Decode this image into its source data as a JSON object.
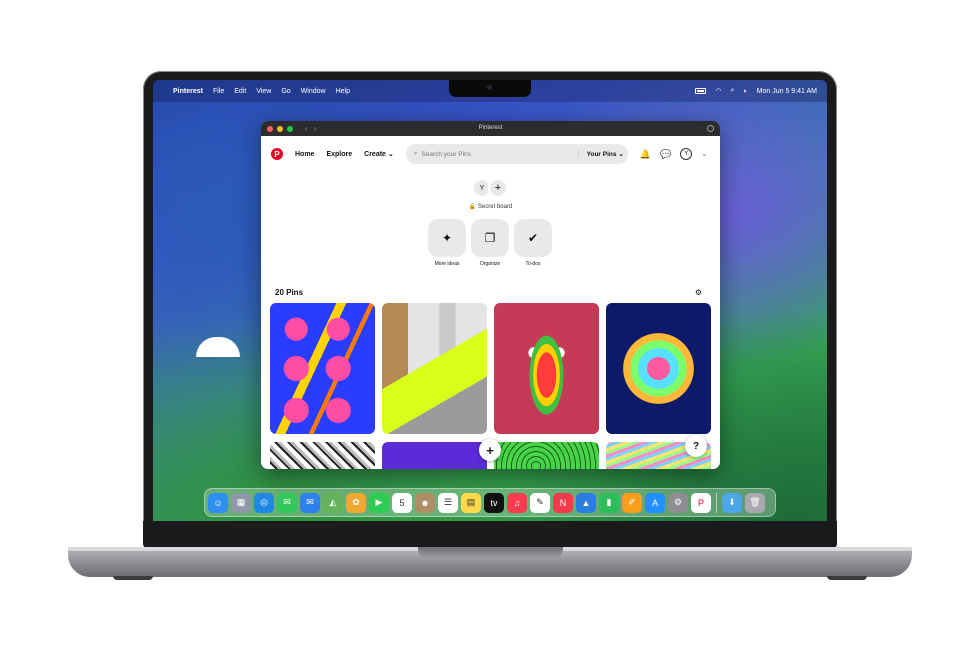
{
  "menubar": {
    "apple": "",
    "app_name": "Pinterest",
    "menus": [
      "File",
      "Edit",
      "View",
      "Go",
      "Window",
      "Help"
    ],
    "clock": "Mon Jun 5  9:41 AM"
  },
  "window": {
    "title": "Pinterest",
    "back": "‹",
    "forward": "›"
  },
  "header": {
    "logo": "P",
    "nav": {
      "home": "Home",
      "explore": "Explore",
      "create": "Create"
    },
    "create_chevron": "⌄",
    "search": {
      "placeholder": "Search your Pins",
      "scope": "Your Pins",
      "scope_chevron": "⌄"
    },
    "profile_initial": "Y",
    "account_chevron": "⌄"
  },
  "board": {
    "collaborator_initial": "Y",
    "add_collaborator": "+",
    "privacy": "Secret board",
    "actions": [
      {
        "label": "More ideas",
        "icon": "✦"
      },
      {
        "label": "Organize",
        "icon": "❐"
      },
      {
        "label": "To-dos",
        "icon": "✔"
      }
    ],
    "pin_count": "20 Pins",
    "filter_icon": "⚙"
  },
  "fabs": {
    "add": "+",
    "help": "?"
  },
  "dock": {
    "apps": [
      {
        "name": "finder-icon",
        "color": "#2f8ff0",
        "glyph": "☺"
      },
      {
        "name": "launchpad-icon",
        "color": "#8f98a8",
        "glyph": "▦"
      },
      {
        "name": "safari-icon",
        "color": "#1e88e5",
        "glyph": "◎"
      },
      {
        "name": "messages-icon",
        "color": "#34c759",
        "glyph": "✉"
      },
      {
        "name": "mail-icon",
        "color": "#2f80ed",
        "glyph": "✉"
      },
      {
        "name": "maps-icon",
        "color": "#62b35a",
        "glyph": "◭"
      },
      {
        "name": "photos-icon",
        "color": "#f0a830",
        "glyph": "✿"
      },
      {
        "name": "facetime-icon",
        "color": "#2ecc52",
        "glyph": "▶"
      },
      {
        "name": "calendar-icon",
        "color": "#ffffff",
        "glyph": "5"
      },
      {
        "name": "contacts-icon",
        "color": "#b08e65",
        "glyph": "☻"
      },
      {
        "name": "reminders-icon",
        "color": "#ffffff",
        "glyph": "☰"
      },
      {
        "name": "notes-icon",
        "color": "#ffd94a",
        "glyph": "▤"
      },
      {
        "name": "tv-icon",
        "color": "#111111",
        "glyph": "tv"
      },
      {
        "name": "music-icon",
        "color": "#fa3b4f",
        "glyph": "♫"
      },
      {
        "name": "freeform-icon",
        "color": "#ffffff",
        "glyph": "✎"
      },
      {
        "name": "news-icon",
        "color": "#f33a4a",
        "glyph": "N"
      },
      {
        "name": "keynote-icon",
        "color": "#2a7de1",
        "glyph": "▲"
      },
      {
        "name": "numbers-icon",
        "color": "#2ebd59",
        "glyph": "▮"
      },
      {
        "name": "pages-icon",
        "color": "#f79e1b",
        "glyph": "✐"
      },
      {
        "name": "app-store-icon",
        "color": "#1e90ff",
        "glyph": "A"
      },
      {
        "name": "system-settings-icon",
        "color": "#8e8e93",
        "glyph": "⚙"
      },
      {
        "name": "pinterest-dock-icon",
        "color": "#ffffff",
        "glyph": "P"
      }
    ],
    "folders": [
      {
        "name": "downloads-folder-icon",
        "color": "#4aa8e8",
        "glyph": "⬇"
      },
      {
        "name": "trash-icon",
        "color": "#a9a9ad",
        "glyph": "🗑"
      }
    ]
  }
}
